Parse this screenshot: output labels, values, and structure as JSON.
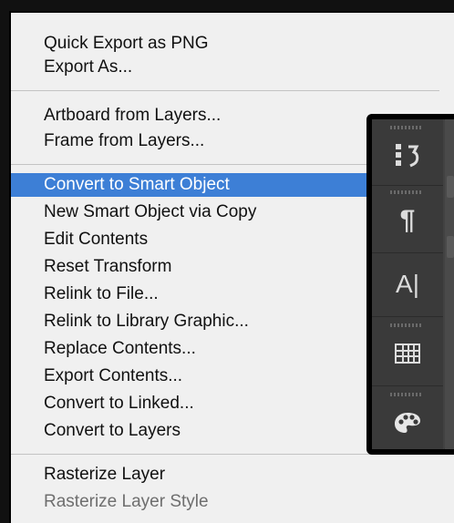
{
  "menu": {
    "groups": [
      {
        "items": [
          {
            "label": "Quick Export as PNG"
          },
          {
            "label": "Export As..."
          }
        ]
      },
      {
        "items": [
          {
            "label": "Artboard from Layers..."
          },
          {
            "label": "Frame from Layers..."
          }
        ]
      },
      {
        "items": [
          {
            "label": "Convert to Smart Object",
            "state": "highlighted"
          },
          {
            "label": "New Smart Object via Copy"
          },
          {
            "label": "Edit Contents"
          },
          {
            "label": "Reset Transform"
          },
          {
            "label": "Relink to File..."
          },
          {
            "label": "Relink to Library Graphic..."
          },
          {
            "label": "Replace Contents..."
          },
          {
            "label": "Export Contents..."
          },
          {
            "label": "Convert to Linked..."
          },
          {
            "label": "Convert to Layers"
          }
        ]
      },
      {
        "items": [
          {
            "label": "Rasterize Layer"
          },
          {
            "label": "Rasterize Layer Style",
            "state": "disabled"
          }
        ]
      }
    ]
  },
  "panel_strip": {
    "icons": [
      {
        "name": "history-icon"
      },
      {
        "name": "paragraph-icon",
        "glyph": "¶"
      },
      {
        "name": "character-icon",
        "glyph": "A|"
      },
      {
        "name": "glyphs-grid-icon"
      },
      {
        "name": "swatches-palette-icon"
      }
    ]
  },
  "colors": {
    "highlight": "#3d7fd6",
    "menu_bg": "#f0f0f0",
    "panel_bg": "#3a3a3a"
  }
}
